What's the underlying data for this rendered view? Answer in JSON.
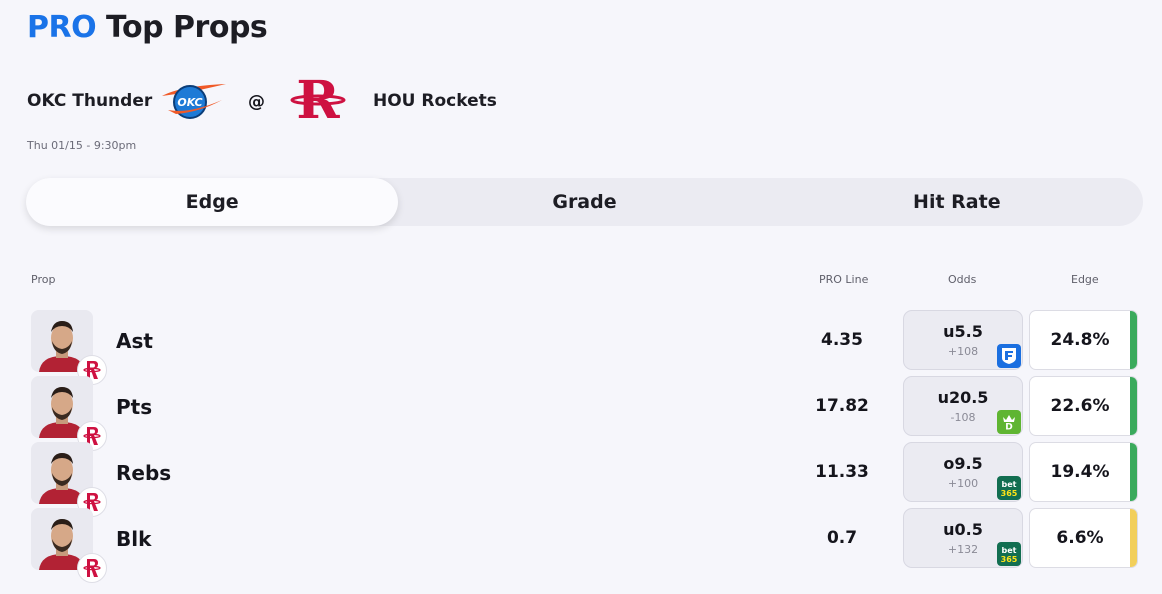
{
  "header": {
    "pro_label": "PRO",
    "title_rest": " Top Props"
  },
  "matchup": {
    "away_team": "OKC Thunder",
    "at_symbol": "@",
    "home_team": "HOU Rockets",
    "datetime": "Thu 01/15 - 9:30pm",
    "away_logo_text": "OKC",
    "home_logo_text": "R"
  },
  "tabs": [
    {
      "label": "Edge",
      "active": true
    },
    {
      "label": "Grade",
      "active": false
    },
    {
      "label": "Hit Rate",
      "active": false
    }
  ],
  "table": {
    "headers": {
      "prop": "Prop",
      "pro_line": "PRO Line",
      "odds": "Odds",
      "edge": "Edge"
    },
    "rows": [
      {
        "stat": "Ast",
        "pro_line": "4.35",
        "odds_line": "u5.5",
        "odds_price": "+108",
        "book": "fanduel-icon",
        "book_text": "",
        "edge": "24.8%",
        "edge_color": "#3aaa5c"
      },
      {
        "stat": "Pts",
        "pro_line": "17.82",
        "odds_line": "u20.5",
        "odds_price": "-108",
        "book": "draftkings-icon",
        "book_text": "",
        "edge": "22.6%",
        "edge_color": "#3aaa5c"
      },
      {
        "stat": "Rebs",
        "pro_line": "11.33",
        "odds_line": "o9.5",
        "odds_price": "+100",
        "book": "bet365-icon",
        "book_text": "bet365",
        "edge": "19.4%",
        "edge_color": "#3aaa5c"
      },
      {
        "stat": "Blk",
        "pro_line": "0.7",
        "odds_line": "u0.5",
        "odds_price": "+132",
        "book": "bet365-icon",
        "book_text": "bet365",
        "edge": "6.6%",
        "edge_color": "#f2cf5b"
      }
    ]
  },
  "colors": {
    "accent": "#1a73e8",
    "positive": "#3aaa5c",
    "neutral": "#f2cf5b"
  }
}
